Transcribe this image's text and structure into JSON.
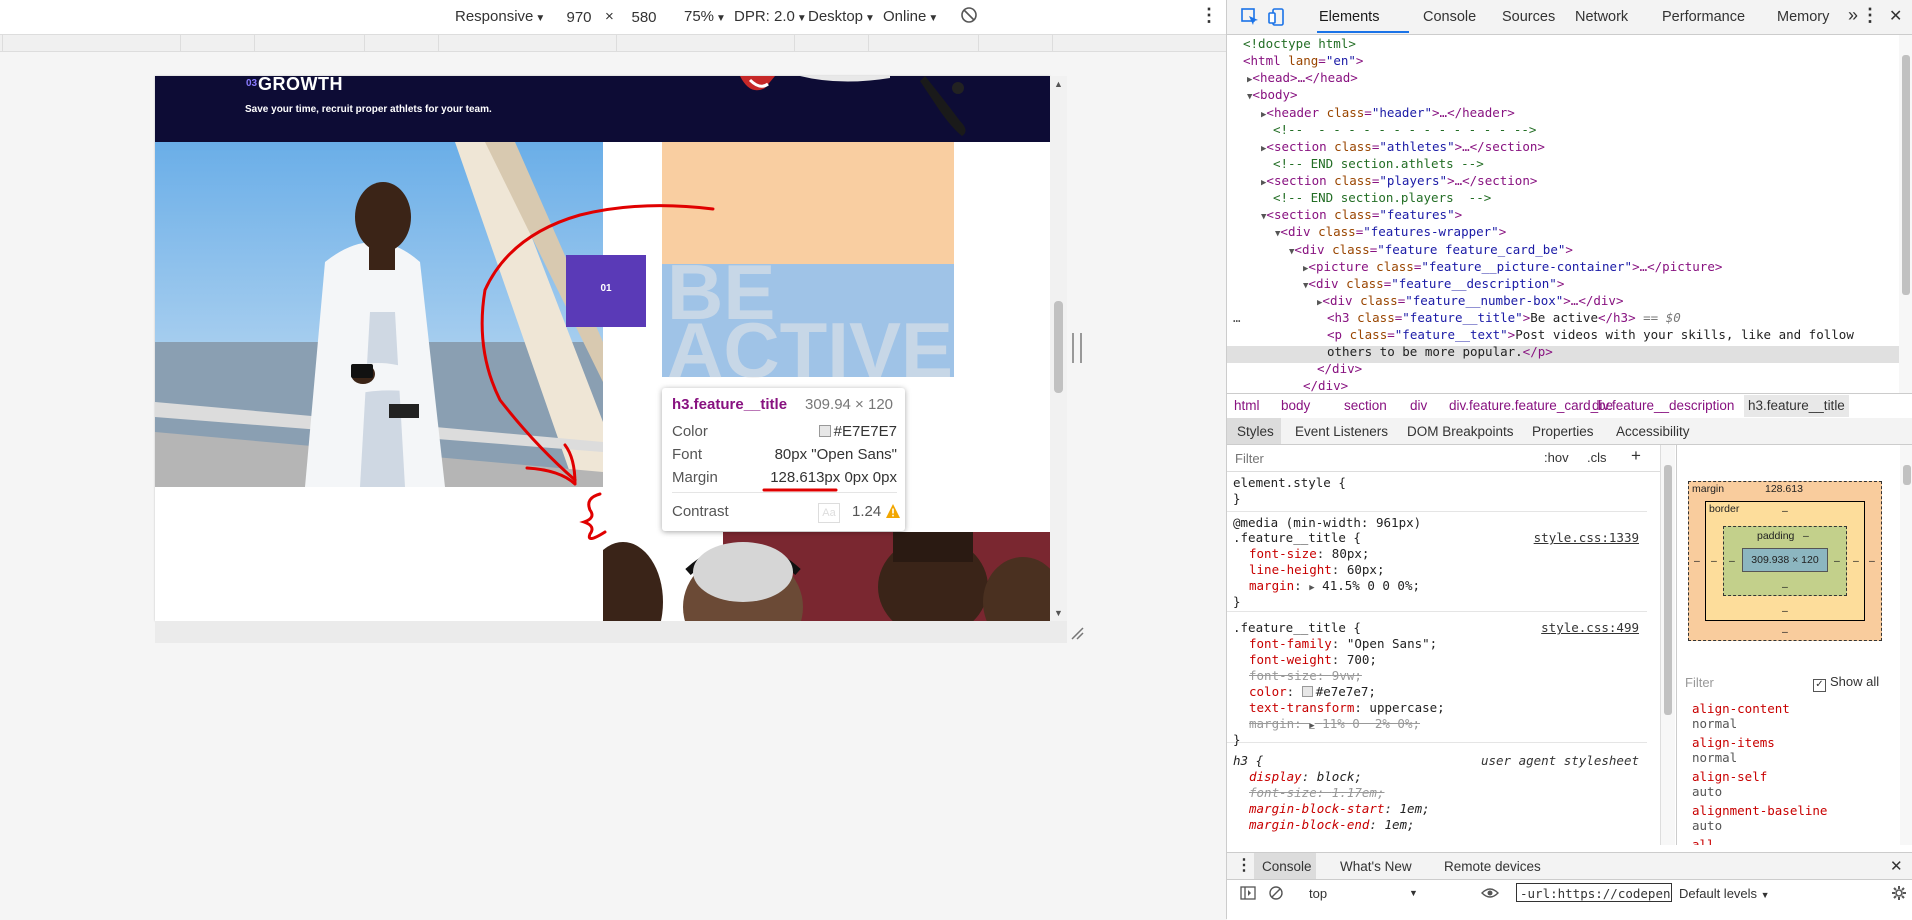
{
  "device_toolbar": {
    "mode": "Responsive",
    "width": "970",
    "times": "×",
    "height": "580",
    "zoom": "75%",
    "dpr": "DPR: 2.0",
    "device_type": "Desktop",
    "network": "Online"
  },
  "site": {
    "section_number": "03",
    "section_title": "GROWTH",
    "section_subtitle": "Save your time, recruit proper athlets for your team.",
    "number_box_label": "01",
    "feature_title": "BE ACTIVE"
  },
  "tooltip": {
    "selector": "h3.feature__title",
    "size": "309.94 × 120",
    "color_label": "Color",
    "color_value": "#E7E7E7",
    "font_label": "Font",
    "font_value": "80px \"Open Sans\"",
    "margin_label": "Margin",
    "margin_value_highlight": "128.613px",
    "margin_value_rest": " 0px 0px",
    "contrast_label": "Contrast",
    "aa_badge": "Aa",
    "contrast_value": "1.24"
  },
  "devtools": {
    "tabs": [
      "Elements",
      "Console",
      "Sources",
      "Network",
      "Performance",
      "Memory"
    ],
    "more": "»",
    "dom": {
      "doctype": "<!doctype html>",
      "html_open": "<html",
      "lang_attr": "lang",
      "lang_val": "\"en\"",
      "head": "<head>…</head>",
      "body": "<body>",
      "header_line_tag": "<header",
      "header_class": "\"header\"",
      "header_rest": ">…</header>",
      "comment1": "<!--  - - - - - - - - - - - - - -->",
      "athletes_class": "\"athletes\"",
      "comment2": "<!-- END section.athlets -->",
      "players_class": "\"players\"",
      "comment3": "<!-- END section.players  -->",
      "features_class": "\"features\"",
      "wrapper_class": "\"features-wrapper\"",
      "card_class": "\"feature feature_card_be\"",
      "picture_class": "\"feature__picture-container\"",
      "desc_class": "\"feature__description\"",
      "numbox_class": "\"feature__number-box\"",
      "title_class": "\"feature__title\"",
      "title_text": "Be active",
      "eq": " == $0",
      "p_class": "\"feature__text\"",
      "p_text_1": "Post videos with your skills, like and follow",
      "p_text_2": "others to be more popular.",
      "div_close": "</div>",
      "ellipsis": "…"
    },
    "breadcrumbs": [
      "html",
      "body",
      "section",
      "div",
      "div.feature.feature_card_be",
      "div.feature__description",
      "h3.feature__title"
    ],
    "sub_tabs": [
      "Styles",
      "Event Listeners",
      "DOM Breakpoints",
      "Properties",
      "Accessibility"
    ],
    "styles": {
      "filter_placeholder": "Filter",
      "hov": ":hov",
      "cls": ".cls",
      "plus": "+",
      "element_style": "element.style {",
      "close": "}",
      "media": "@media (min-width: 961px)",
      "sel1": ".feature__title {",
      "src1": "style.css:1339",
      "r1_p1": "font-size",
      "r1_v1": "80px;",
      "r1_p2": "line-height",
      "r1_v2": "60px;",
      "r1_p3": "margin",
      "r1_v3": "41.5% 0 0 0%;",
      "sel2": ".feature__title {",
      "src2": "style.css:499",
      "r2_p1": "font-family",
      "r2_v1": "\"Open Sans\";",
      "r2_p2": "font-weight",
      "r2_v2": "700;",
      "r2_p3": "font-size",
      "r2_v3": "9vw;",
      "r2_p4": "color",
      "r2_v4": "#e7e7e7;",
      "r2_p5": "text-transform",
      "r2_v5": "uppercase;",
      "r2_p6": "margin",
      "r2_v6": "11% 0  2% 0%;",
      "sel3": "h3 {",
      "ua": "user agent stylesheet",
      "r3_p1": "display",
      "r3_v1": "block;",
      "r3_p2": "font-size",
      "r3_v2": "1.17em;",
      "r3_p3": "margin-block-start",
      "r3_v3": "1em;",
      "r3_p4": "margin-block-end",
      "r3_v4": "1em;"
    },
    "box_model": {
      "margin_label": "margin",
      "margin_value": "128.613",
      "border_label": "border",
      "padding_label": "padding",
      "dash": "–",
      "content": "309.938 × 120"
    },
    "computed": {
      "filter": "Filter",
      "show_all": "Show all",
      "check": "✓",
      "props": [
        {
          "name": "align-content",
          "value": "normal"
        },
        {
          "name": "align-items",
          "value": "normal"
        },
        {
          "name": "align-self",
          "value": "auto"
        },
        {
          "name": "alignment-baseline",
          "value": "auto"
        },
        {
          "name": "all",
          "value": ""
        }
      ]
    },
    "drawer": {
      "tabs": [
        "Console",
        "What's New",
        "Remote devices"
      ],
      "context": "top",
      "url_filter": "-url:https://codepen.io",
      "levels": "Default levels"
    }
  },
  "colors": {
    "brand_navy": "#0d0c35",
    "number_box": "#5a3ab7",
    "margin_overlay": "#f9cb9c",
    "content_overlay": "#9fc3e7",
    "annotation_red": "#e00000"
  }
}
